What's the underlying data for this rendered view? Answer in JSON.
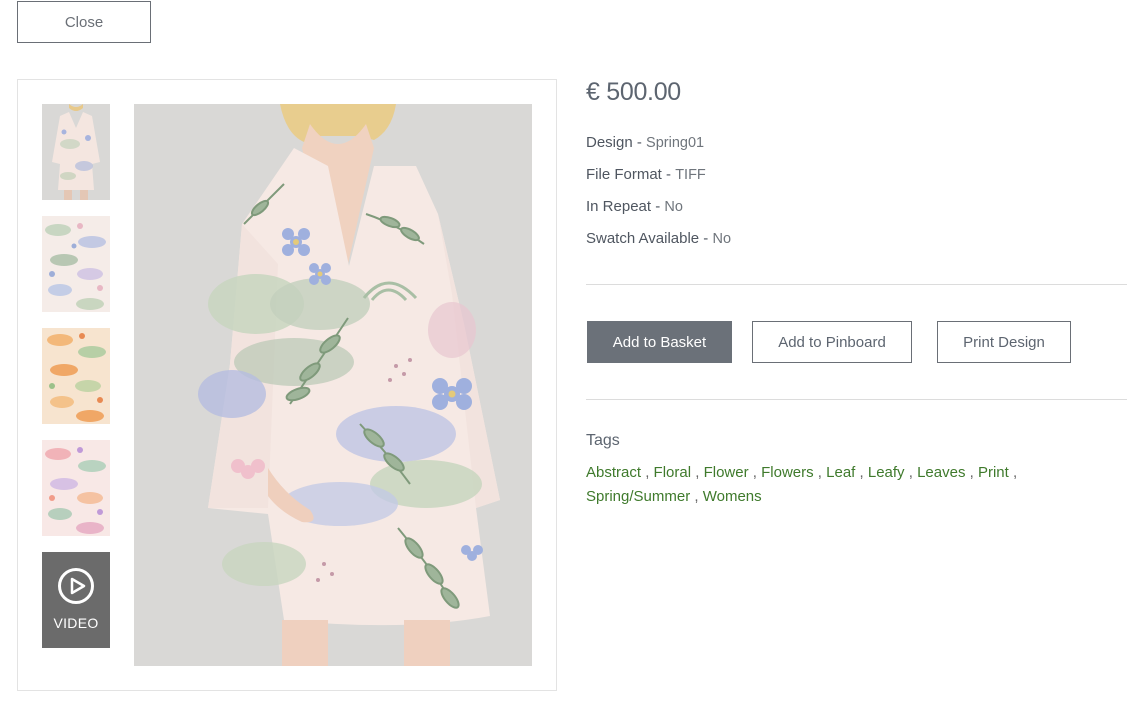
{
  "close_label": "Close",
  "gallery": {
    "thumbnails": [
      {
        "name": "thumb-dress"
      },
      {
        "name": "thumb-pattern-pastel"
      },
      {
        "name": "thumb-pattern-orange"
      },
      {
        "name": "thumb-pattern-pink"
      }
    ],
    "video_label": "VIDEO"
  },
  "product": {
    "price": "€ 500.00",
    "specs": [
      {
        "key": "Design -",
        "value": "Spring01"
      },
      {
        "key": "File Format -",
        "value": "TIFF"
      },
      {
        "key": "In Repeat -",
        "value": "No"
      },
      {
        "key": "Swatch Available -",
        "value": "No"
      }
    ]
  },
  "actions": {
    "add_to_basket": "Add to Basket",
    "add_to_pinboard": "Add to Pinboard",
    "print_design": "Print Design"
  },
  "tags": {
    "title": "Tags",
    "items": [
      "Abstract",
      "Floral",
      "Flower",
      "Flowers",
      "Leaf",
      "Leafy",
      "Leaves",
      "Print",
      "Spring/Summer",
      "Womens"
    ],
    "separator": " , "
  },
  "colors": {
    "primary_button": "#6b7179",
    "tag_link": "#3f7a2c",
    "text": "#5d6570"
  },
  "icons": {
    "video": "play-circle-icon"
  }
}
